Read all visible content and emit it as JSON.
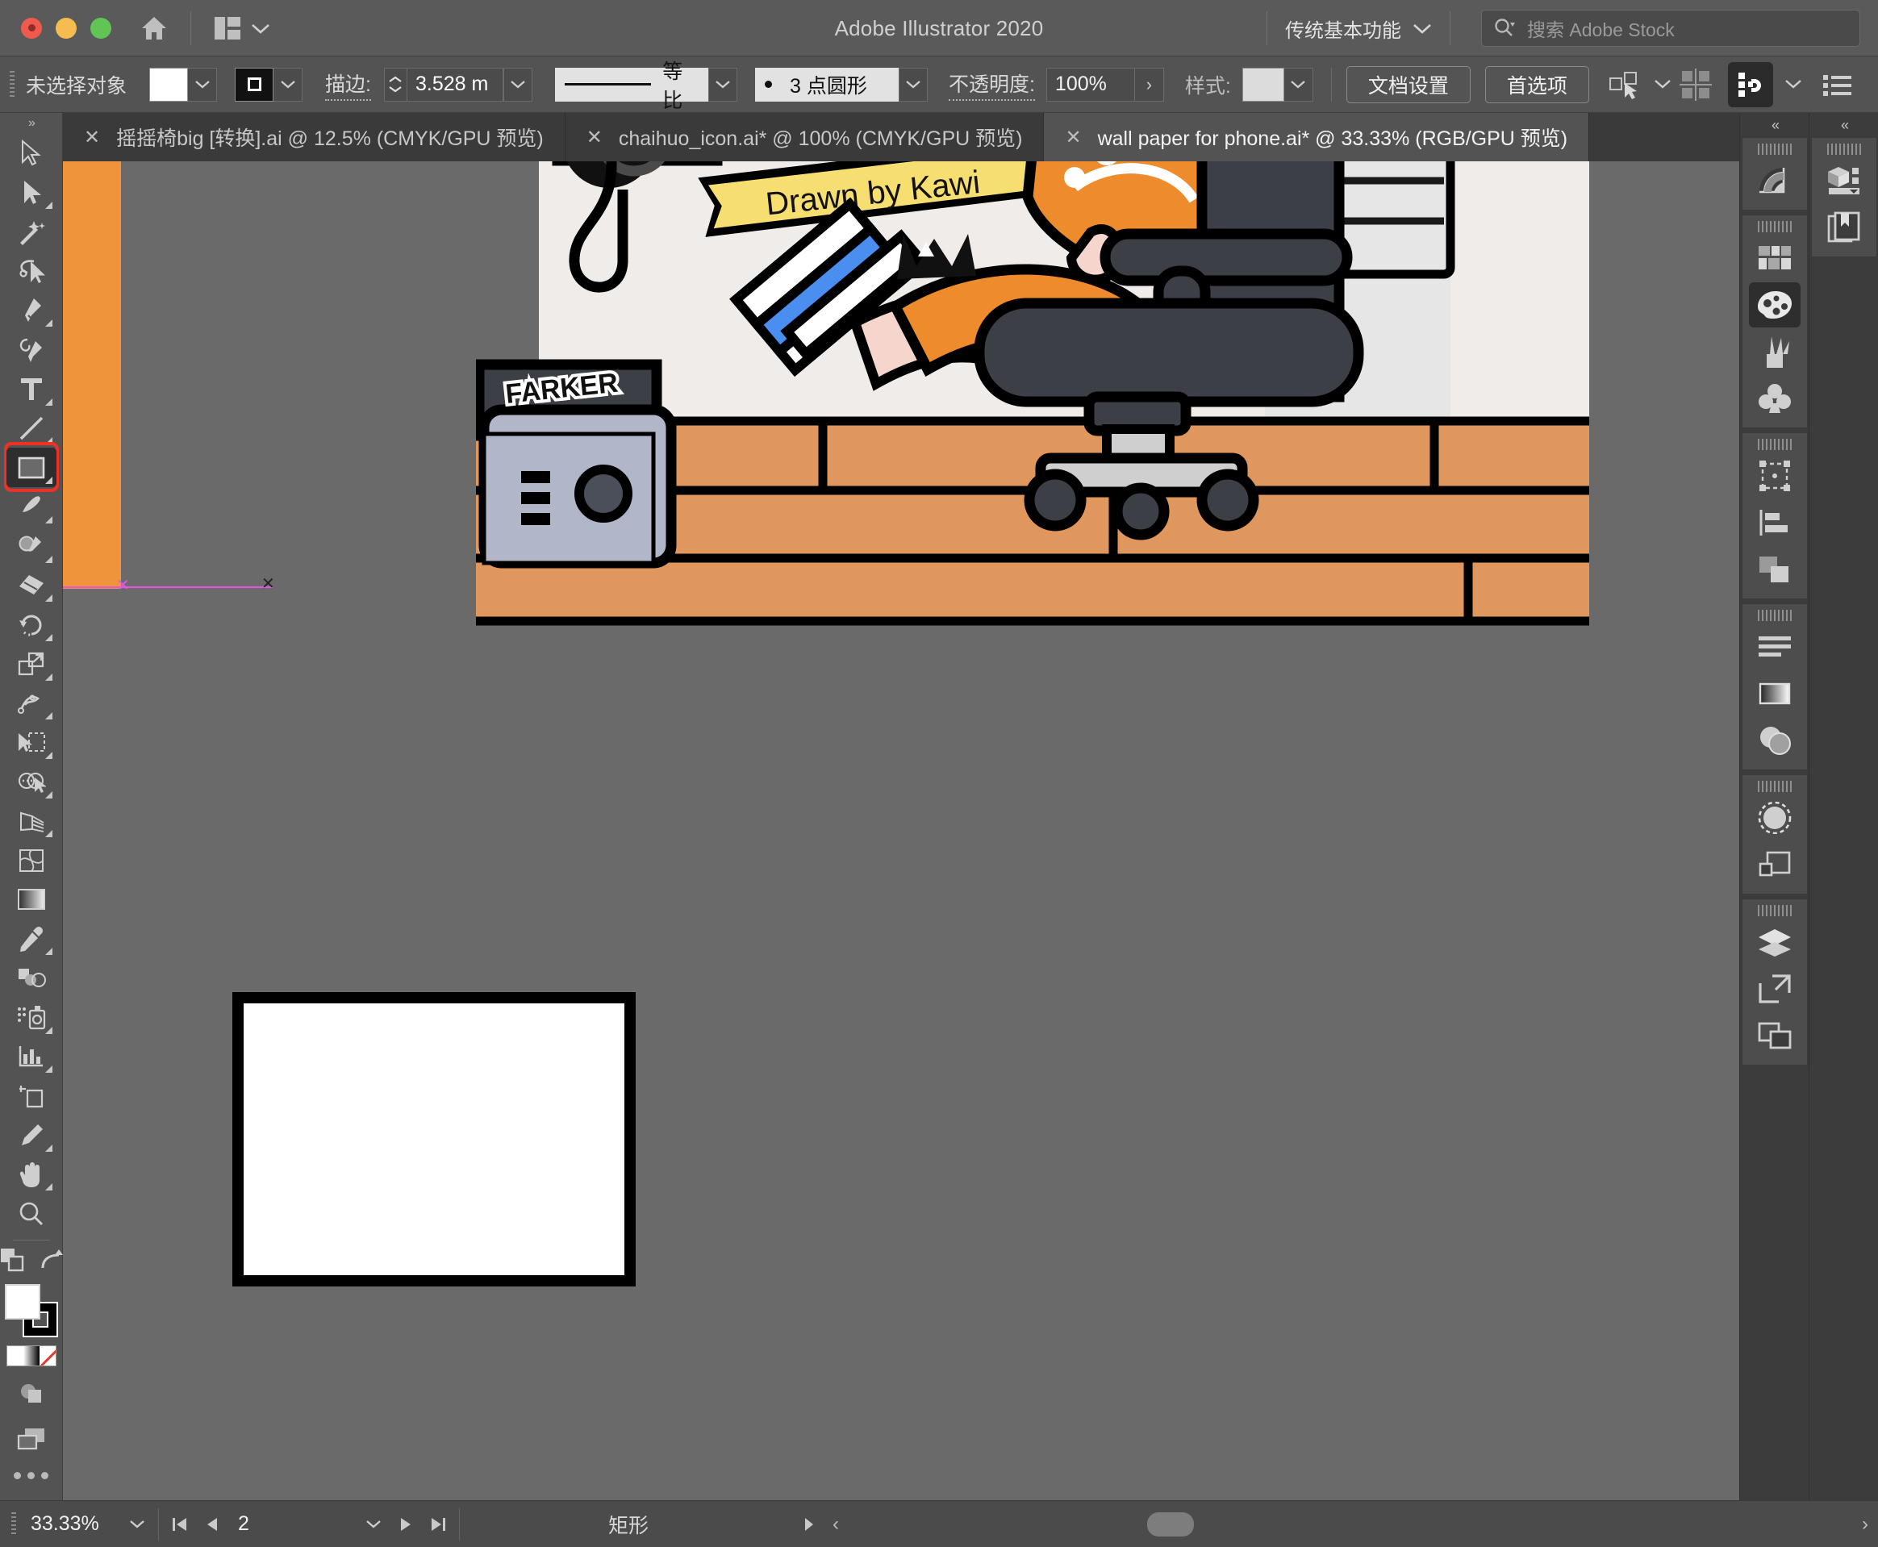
{
  "app": {
    "title": "Adobe Illustrator 2020",
    "workspace": "传统基本功能",
    "stock_placeholder": "搜索 Adobe Stock",
    "window_controls": [
      "close",
      "minimize",
      "zoom"
    ]
  },
  "control_bar": {
    "selection_status": "未选择对象",
    "fill_color": "#ffffff",
    "stroke_swatch_kind": "stroke-box",
    "stroke_label": "描边:",
    "stroke_width": "3.528 m",
    "profile_label": "等比",
    "brush_label": "3 点圆形",
    "opacity_label": "不透明度:",
    "opacity_value": "100%",
    "style_label": "样式:",
    "style_color": "#dcdcdc",
    "document_setup": "文档设置",
    "preferences": "首选项",
    "select_similar_icon": "select-similar-icon",
    "align_icon": "align-icon",
    "transform_icon": "transform-panel-icon",
    "options_icon": "options-list-icon"
  },
  "tabs": [
    {
      "label": "摇摇椅big [转换].ai @ 12.5% (CMYK/GPU 预览)",
      "active": false
    },
    {
      "label": "chaihuo_icon.ai* @ 100% (CMYK/GPU 预览)",
      "active": false
    },
    {
      "label": "wall paper for phone.ai* @ 33.33% (RGB/GPU 预览)",
      "active": true
    }
  ],
  "toolbar": {
    "groups": [
      {
        "tools": [
          {
            "name": "selection-tool",
            "selected": false,
            "has_flyout": false
          },
          {
            "name": "direct-selection-tool",
            "selected": false,
            "has_flyout": true
          },
          {
            "name": "magic-wand-tool",
            "selected": false,
            "has_flyout": false
          },
          {
            "name": "lasso-tool",
            "selected": false,
            "has_flyout": false
          },
          {
            "name": "pen-tool",
            "selected": false,
            "has_flyout": true
          },
          {
            "name": "curvature-tool",
            "selected": false,
            "has_flyout": false
          },
          {
            "name": "type-tool",
            "selected": false,
            "has_flyout": true
          },
          {
            "name": "line-segment-tool",
            "selected": false,
            "has_flyout": true
          },
          {
            "name": "rectangle-tool",
            "selected": true,
            "has_flyout": true
          },
          {
            "name": "paintbrush-tool",
            "selected": false,
            "has_flyout": true
          },
          {
            "name": "shaper-tool",
            "selected": false,
            "has_flyout": true
          },
          {
            "name": "eraser-tool",
            "selected": false,
            "has_flyout": true
          },
          {
            "name": "rotate-tool",
            "selected": false,
            "has_flyout": true
          },
          {
            "name": "scale-tool",
            "selected": false,
            "has_flyout": true
          },
          {
            "name": "width-tool",
            "selected": false,
            "has_flyout": true
          },
          {
            "name": "free-transform-tool",
            "selected": false,
            "has_flyout": true
          },
          {
            "name": "shape-builder-tool",
            "selected": false,
            "has_flyout": true
          },
          {
            "name": "perspective-grid-tool",
            "selected": false,
            "has_flyout": true
          },
          {
            "name": "mesh-tool",
            "selected": false,
            "has_flyout": false
          },
          {
            "name": "gradient-tool",
            "selected": false,
            "has_flyout": false
          },
          {
            "name": "eyedropper-tool",
            "selected": false,
            "has_flyout": true
          },
          {
            "name": "blend-tool",
            "selected": false,
            "has_flyout": false
          },
          {
            "name": "symbol-sprayer-tool",
            "selected": false,
            "has_flyout": true
          },
          {
            "name": "column-graph-tool",
            "selected": false,
            "has_flyout": true
          },
          {
            "name": "artboard-tool",
            "selected": false,
            "has_flyout": false
          },
          {
            "name": "slice-tool",
            "selected": false,
            "has_flyout": true
          },
          {
            "name": "hand-tool",
            "selected": false,
            "has_flyout": true
          },
          {
            "name": "zoom-tool",
            "selected": false,
            "has_flyout": false
          }
        ]
      }
    ],
    "bottom": {
      "swap_fill_stroke_icon": "swap-fill-stroke-icon",
      "default_fill_stroke_icon": "default-fill-stroke-icon",
      "fill_color": "#ffffff",
      "stroke_color": "#000000",
      "mini_swatches": [
        "color",
        "gradient",
        "none"
      ],
      "drawing_mode_icon": "drawing-mode-icon",
      "screen_mode_icon": "screen-mode-icon",
      "more_tools_icon": "more-tools-icon"
    }
  },
  "canvas": {
    "artboard_fill": "#f0943c",
    "background": "#6a6a6a",
    "guide_color": "#e455e4",
    "selected_shape": {
      "name": "rectangle",
      "fill": "#ffffff",
      "stroke": "#000000"
    },
    "artwork": {
      "sticker_text": "Drawn by Kawi",
      "graffiti_text": "FARKER",
      "sticker_color": "#f7de70",
      "wall_color": "#f0ece9",
      "brick_color": "#e0975e",
      "chair_color": "#3c3f46",
      "hoodie_color": "#ee8b2c",
      "shoe_color": "#4a8ff0"
    }
  },
  "right_dock": {
    "collapse_icon": "collapse-panels-icon",
    "column_a": [
      {
        "group": 1,
        "items": [
          {
            "name": "color-panel-icon",
            "selected": false
          }
        ]
      },
      {
        "group": 2,
        "items": [
          {
            "name": "swatches-panel-icon",
            "selected": false
          },
          {
            "name": "color-guide-panel-icon",
            "selected": true
          },
          {
            "name": "brushes-panel-icon",
            "selected": false
          },
          {
            "name": "symbols-panel-icon",
            "selected": false
          }
        ]
      },
      {
        "group": 3,
        "items": [
          {
            "name": "transform-panel-icon",
            "selected": false
          },
          {
            "name": "align-panel-icon",
            "selected": false
          },
          {
            "name": "pathfinder-panel-icon",
            "selected": false
          }
        ]
      },
      {
        "group": 4,
        "items": [
          {
            "name": "paragraph-panel-icon",
            "selected": false
          },
          {
            "name": "gradient-panel-icon",
            "selected": false
          },
          {
            "name": "transparency-panel-icon",
            "selected": false
          }
        ]
      },
      {
        "group": 5,
        "items": [
          {
            "name": "appearance-panel-icon",
            "selected": false
          },
          {
            "name": "graphic-styles-panel-icon",
            "selected": false
          }
        ]
      },
      {
        "group": 6,
        "items": [
          {
            "name": "layers-panel-icon",
            "selected": false
          },
          {
            "name": "artboards-panel-icon",
            "selected": false
          },
          {
            "name": "asset-export-panel-icon",
            "selected": false
          }
        ]
      }
    ],
    "column_b": [
      {
        "group": 1,
        "items": [
          {
            "name": "libraries-panel-icon",
            "selected": false
          },
          {
            "name": "bookmarks-panel-icon",
            "selected": false
          }
        ]
      }
    ]
  },
  "status_bar": {
    "zoom_level": "33.33%",
    "artboard_number": "2",
    "status_text": "矩形",
    "first_icon": "first-artboard-icon",
    "prev_icon": "prev-artboard-icon",
    "next_icon": "next-artboard-icon",
    "last_icon": "last-artboard-icon",
    "menu_arrow": "status-menu-arrow"
  }
}
